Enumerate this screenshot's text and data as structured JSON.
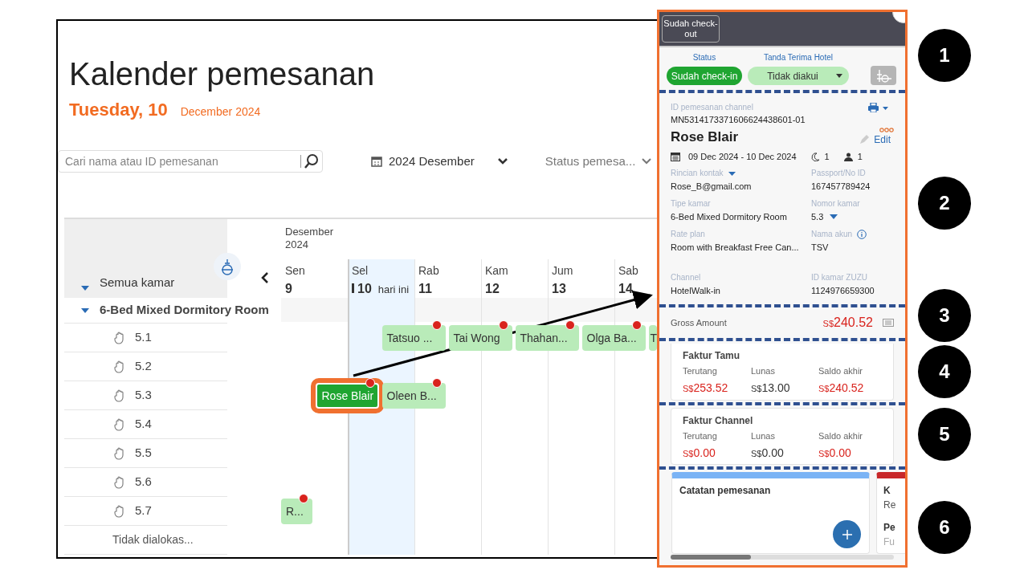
{
  "calendar": {
    "title": "Kalender pemesanan",
    "today": "Tuesday, 10",
    "month_year": "December 2024",
    "search": {
      "placeholder": "Cari nama atau ID pemesanan"
    },
    "month_picker": "2024 Desember",
    "status_filter": "Status pemesa...",
    "month_label": "Desember 2024",
    "days": [
      {
        "name": "Sen",
        "number": "9",
        "today": false
      },
      {
        "name": "Sel",
        "number": "10",
        "today": true,
        "today_label": "hari ini"
      },
      {
        "name": "Rab",
        "number": "11",
        "today": false
      },
      {
        "name": "Kam",
        "number": "12",
        "today": false
      },
      {
        "name": "Jum",
        "number": "13",
        "today": false
      },
      {
        "name": "Sab",
        "number": "14",
        "today": false
      }
    ],
    "rooms": {
      "label": "Semua kamar",
      "expanded": true,
      "children": [
        {
          "label": "6-Bed Mixed Dormitory Room",
          "expanded": true,
          "children": [
            {
              "label": "5.1",
              "slots": [
                {
                  "kind": "empty"
                },
                {
                  "kind": "empty"
                },
                {
                  "kind": "booking",
                  "guest": "Tatsuo ...",
                  "selected": false,
                  "alert": true
                },
                {
                  "kind": "booking",
                  "guest": "Tai Wong",
                  "selected": false,
                  "alert": true
                },
                {
                  "kind": "booking",
                  "guest": "Thahan...",
                  "selected": false,
                  "alert": true
                },
                {
                  "kind": "booking",
                  "guest": "Olga Ba...",
                  "selected": false,
                  "alert": true
                },
                {
                  "kind": "booking",
                  "guest": "T",
                  "selected": false,
                  "alert": false
                }
              ]
            },
            {
              "label": "5.2"
            },
            {
              "label": "5.3",
              "slots": [
                {
                  "kind": "empty"
                },
                {
                  "kind": "booking",
                  "guest": "Rose Blair",
                  "selected": true,
                  "alert": true
                },
                {
                  "kind": "booking",
                  "guest": "Oleen B...",
                  "selected": false,
                  "alert": true
                }
              ]
            },
            {
              "label": "5.4"
            },
            {
              "label": "5.5"
            },
            {
              "label": "5.6"
            },
            {
              "label": "5.7",
              "slots": [
                {
                  "kind": "booking",
                  "guest": "R...",
                  "selected": false,
                  "alert": true
                }
              ]
            }
          ]
        }
      ]
    },
    "unallocated": "Tidak dialokas..."
  },
  "panel": {
    "header_button": "Sudah check-out",
    "status": {
      "label": "Status",
      "value": "Sudah check-in"
    },
    "receipt": {
      "label": "Tanda Terima Hotel",
      "value": "Tidak diakui"
    },
    "channel_id_label": "ID pemesanan channel",
    "channel_id": "MN5314173371606624438601-01",
    "guest_name": "Rose Blair",
    "edit": "Edit",
    "dates": "09 Dec 2024 - 10 Dec 2024",
    "nights": "1",
    "guests": "1",
    "fields": [
      {
        "label": "Rincian kontak",
        "value": "Rose_B@gmail.com",
        "kind": "label_dropdown"
      },
      {
        "label": "Passport/No ID",
        "value": "167457789424",
        "kind": "plain"
      },
      {
        "label": "Tipe kamar",
        "value": "6-Bed Mixed Dormitory Room",
        "kind": "plain"
      },
      {
        "label": "Nomor kamar",
        "value": "5.3",
        "kind": "value_dropdown"
      },
      {
        "label": "Rate plan",
        "value": "Room with Breakfast Free Can...",
        "kind": "plain"
      },
      {
        "label": "Nama akun",
        "value": "TSV",
        "kind": "info"
      },
      {
        "label": "Channel",
        "value": "HotelWalk-in",
        "kind": "plain"
      },
      {
        "label": "ID kamar ZUZU",
        "value": "1124976659300",
        "kind": "plain"
      }
    ],
    "gross": {
      "label": "Gross Amount",
      "currency": "S$",
      "amount": "240.52"
    },
    "invoices": [
      {
        "title": "Faktur Tamu",
        "columns": [
          {
            "label": "Terutang",
            "currency": "S$",
            "amount": "253.52",
            "due": true
          },
          {
            "label": "Lunas",
            "currency": "S$",
            "amount": "13.00",
            "due": false
          },
          {
            "label": "Saldo akhir",
            "currency": "S$",
            "amount": "240.52",
            "due": true
          }
        ]
      },
      {
        "title": "Faktur Channel",
        "columns": [
          {
            "label": "Terutang",
            "currency": "S$",
            "amount": "0.00",
            "due": true
          },
          {
            "label": "Lunas",
            "currency": "S$",
            "amount": "0.00",
            "due": false
          },
          {
            "label": "Saldo akhir",
            "currency": "S$",
            "amount": "0.00",
            "due": true
          }
        ]
      }
    ],
    "notes": {
      "title": "Catatan pemesanan"
    },
    "next_card": {
      "title": "K",
      "line_1": "Re",
      "heading_2": "Pe",
      "line_2": "Fu"
    }
  },
  "callouts": [
    "1",
    "2",
    "3",
    "4",
    "5",
    "6"
  ]
}
